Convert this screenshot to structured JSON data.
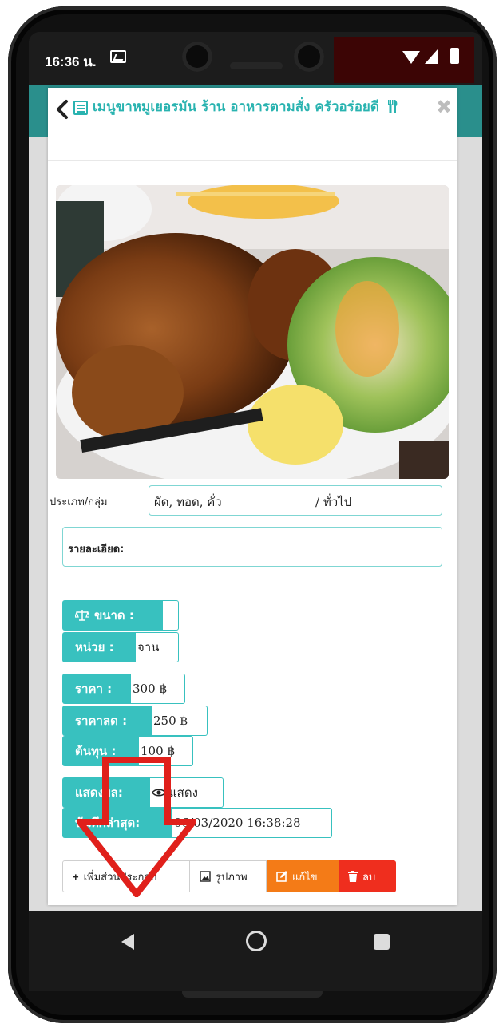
{
  "status_bar": {
    "time": "16:36 น."
  },
  "modal": {
    "title": "เมนูขาหมูเยอรมัน ร้าน อาหารตามสั่ง ครัวอร่อยดี",
    "close_label": "✖"
  },
  "category": {
    "label": "ประเภท/กลุ่ม",
    "type_value": "ผัด, ทอด, คั่ว",
    "group_value": "/ ทั่วไป"
  },
  "details": {
    "label": "รายละเอียด:"
  },
  "size": {
    "label": "ขนาด :",
    "value": ""
  },
  "unit": {
    "label": "หน่วย :",
    "value": "จาน"
  },
  "price": {
    "label": "ราคา :",
    "value": "300 ฿"
  },
  "discount_price": {
    "label": "ราคาลด :",
    "value": "250 ฿"
  },
  "cost": {
    "label": "ต้นทุน :",
    "value": "100 ฿"
  },
  "display": {
    "label": "แสดงผล:",
    "value": "แสดง"
  },
  "last_saved": {
    "label": "บันทึกล่าสุด:",
    "value": "06/03/2020 16:38:28"
  },
  "actions": {
    "add_label": "เพิ่มส่วนประกอบ",
    "image_label": "รูปภาพ",
    "edit_label": "แก้ไข",
    "delete_label": "ลบ"
  },
  "colors": {
    "accent": "#38c1bf",
    "edit": "#f47b17",
    "delete": "#ef2e1e",
    "overlay_arrow": "#e0201b"
  }
}
